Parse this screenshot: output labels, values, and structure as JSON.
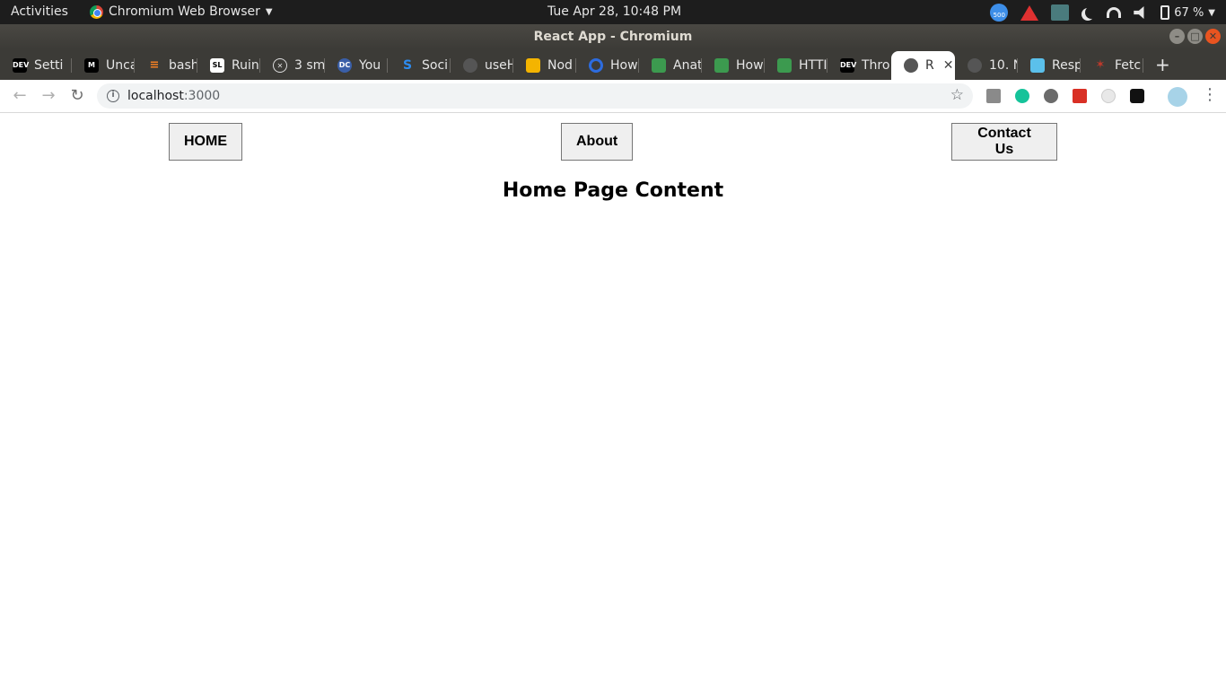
{
  "topbar": {
    "activities": "Activities",
    "app_name": "Chromium Web Browser",
    "clock": "Tue Apr 28, 10:48 PM",
    "battery": "67 %"
  },
  "window": {
    "title": "React App - Chromium"
  },
  "tabs": [
    {
      "label": "Setti",
      "icon": "dev-icon"
    },
    {
      "label": "Unca",
      "icon": "medium-icon"
    },
    {
      "label": "bash",
      "icon": "stackoverflow-icon"
    },
    {
      "label": "Ruin",
      "icon": "sl-icon"
    },
    {
      "label": "3 sm",
      "icon": "x-circle-icon"
    },
    {
      "label": "You",
      "icon": "dc-icon"
    },
    {
      "label": "Soci",
      "icon": "s-icon"
    },
    {
      "label": "useH",
      "icon": "globe-icon"
    },
    {
      "label": "Nod",
      "icon": "slides-icon"
    },
    {
      "label": "How",
      "icon": "c-icon"
    },
    {
      "label": "Anat",
      "icon": "node-icon"
    },
    {
      "label": "How",
      "icon": "node-icon"
    },
    {
      "label": "HTTI",
      "icon": "node-icon"
    },
    {
      "label": "Thro",
      "icon": "dev-icon"
    },
    {
      "label": "R",
      "icon": "globe-icon",
      "active": true
    },
    {
      "label": "10. N",
      "icon": "globe-icon"
    },
    {
      "label": "Resp",
      "icon": "bookmark-icon"
    },
    {
      "label": "Fetc",
      "icon": "tiger-icon"
    }
  ],
  "address_bar": {
    "host": "localhost",
    "port": ":3000"
  },
  "page": {
    "buttons": {
      "home": "HOME",
      "about": "About",
      "contact": "Contact Us"
    },
    "heading": "Home Page Content"
  }
}
